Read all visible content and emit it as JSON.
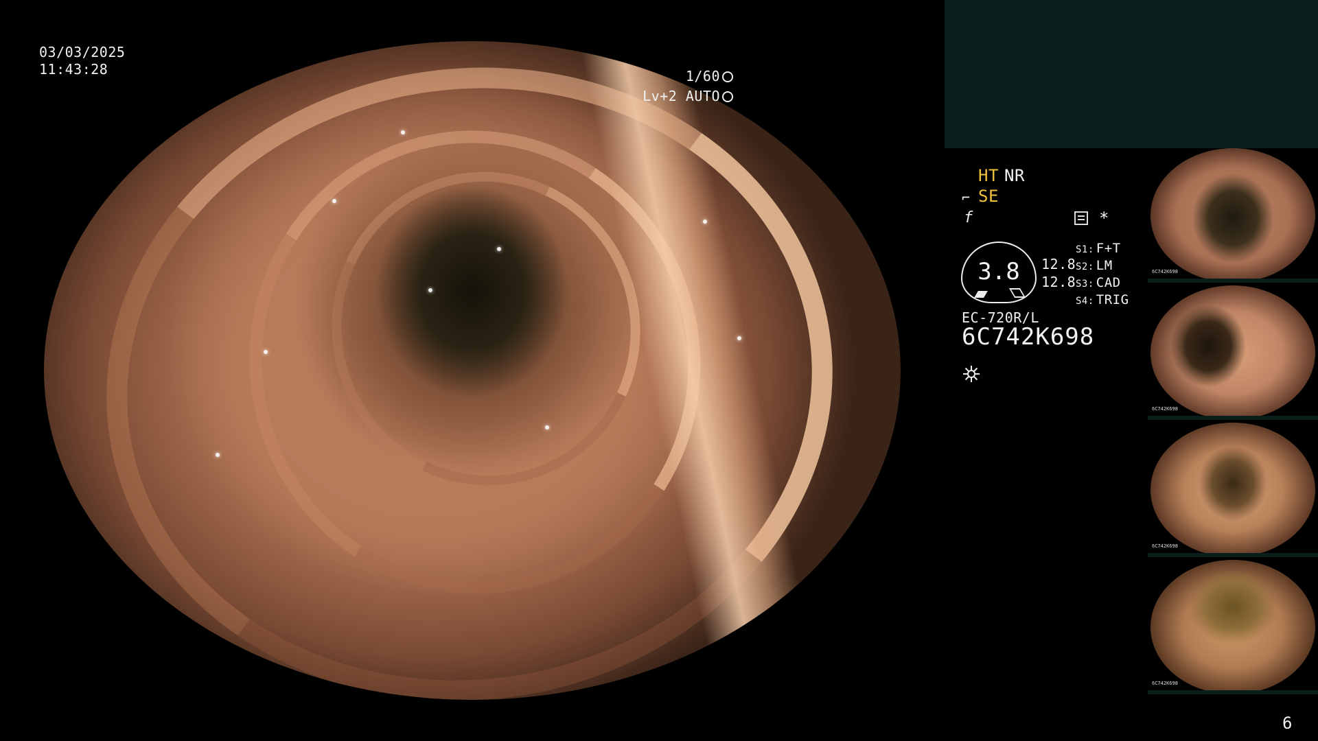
{
  "overlay": {
    "date": "03/03/2025",
    "time": "11:43:28",
    "shutter": "1/60",
    "level": "Lv+2 AUTO"
  },
  "status": {
    "ht": "HT",
    "nr": "NR",
    "se": "SE",
    "f_icon": "f",
    "star": "*",
    "gauge_value": "3.8",
    "gauge_right_top": "12.8",
    "gauge_right_bottom": "12.8",
    "s1_key": "S1:",
    "s1_val": "F+T",
    "s2_key": "S2:",
    "s2_val": "LM",
    "s3_key": "S3:",
    "s3_val": "CAD",
    "s4_key": "S4:",
    "s4_val": "TRIG",
    "model": "EC-720R/L",
    "serial": "6C742K698"
  },
  "thumbnails": [
    {
      "serial": "6C742K698"
    },
    {
      "serial": "6C742K698"
    },
    {
      "serial": "6C742K698"
    },
    {
      "serial": "6C742K698"
    }
  ],
  "page_number": "6",
  "colors": {
    "background": "#000000",
    "panel": "#0b1e1b",
    "accent_yellow": "#f0c23a",
    "osd_text": "#f2f2f2"
  },
  "icons": [
    "shutter-icon",
    "auto-exposure-icon",
    "scope-angle-icon",
    "freeze-icon",
    "memo-icon",
    "light-icon"
  ]
}
